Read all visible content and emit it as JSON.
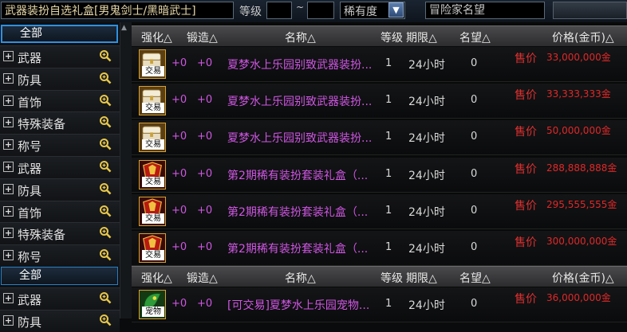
{
  "top": {
    "search_value": "武器装扮自选礼盒[男鬼剑士/黑暗武士]",
    "level_label": "等级",
    "level_sep": "~",
    "rarity_label": "稀有度",
    "adventurer_label": "冒险家名望"
  },
  "sidebar": {
    "groups": [
      {
        "all_label": "全部",
        "items": [
          "武器",
          "防具",
          "首饰",
          "特殊装备",
          "称号",
          "武器",
          "防具",
          "首饰",
          "特殊装备",
          "称号"
        ]
      },
      {
        "all_label": "全部",
        "items": [
          "武器",
          "防具"
        ]
      }
    ]
  },
  "table": {
    "headers": {
      "strengthen": "强化△",
      "forge": "锻造△",
      "name": "名称△",
      "level": "等级",
      "period": "期限△",
      "fame": "名望△",
      "price": "价格(金币)△"
    },
    "rows": [
      {
        "icon": "chest-icon",
        "badge": "交易",
        "strengthen": "+0",
        "forge": "+0",
        "name": "夏梦水上乐园别致武器装扮...",
        "qty": "1",
        "period": "24小时",
        "fame": "0",
        "price_label": "售价",
        "price": "33,000,000金"
      },
      {
        "icon": "chest-icon",
        "badge": "交易",
        "strengthen": "+0",
        "forge": "+0",
        "name": "夏梦水上乐园别致武器装扮...",
        "qty": "1",
        "period": "24小时",
        "fame": "0",
        "price_label": "售价",
        "price": "33,333,333金"
      },
      {
        "icon": "chest-icon",
        "badge": "交易",
        "strengthen": "+0",
        "forge": "+0",
        "name": "夏梦水上乐园别致武器装扮...",
        "qty": "1",
        "period": "24小时",
        "fame": "0",
        "price_label": "售价",
        "price": "50,000,000金"
      },
      {
        "icon": "costume-box-icon",
        "badge": "交易",
        "strengthen": "+0",
        "forge": "+0",
        "name": "第2期稀有装扮套装礼盒（...",
        "qty": "1",
        "period": "24小时",
        "fame": "0",
        "price_label": "售价",
        "price": "288,888,888金"
      },
      {
        "icon": "costume-box-icon",
        "badge": "交易",
        "strengthen": "+0",
        "forge": "+0",
        "name": "第2期稀有装扮套装礼盒（...",
        "qty": "1",
        "period": "24小时",
        "fame": "0",
        "price_label": "售价",
        "price": "295,555,555金"
      },
      {
        "icon": "costume-box-icon",
        "badge": "交易",
        "strengthen": "+0",
        "forge": "+0",
        "name": "第2期稀有装扮套装礼盒（...",
        "qty": "1",
        "period": "24小时",
        "fame": "0",
        "price_label": "售价",
        "price": "300,000,000金"
      }
    ],
    "rows2": [
      {
        "icon": "pet-icon",
        "badge": "宠物",
        "strengthen": "+0",
        "forge": "+0",
        "name": "[可交易]夏梦水上乐园宠物...",
        "qty": "1",
        "period": "24小时",
        "fame": "0",
        "price_label": "售价",
        "price": "36,000,000金"
      }
    ]
  },
  "colors": {
    "accent": "#2f90e0",
    "price": "#e02828",
    "item_name": "#cf56e3"
  }
}
